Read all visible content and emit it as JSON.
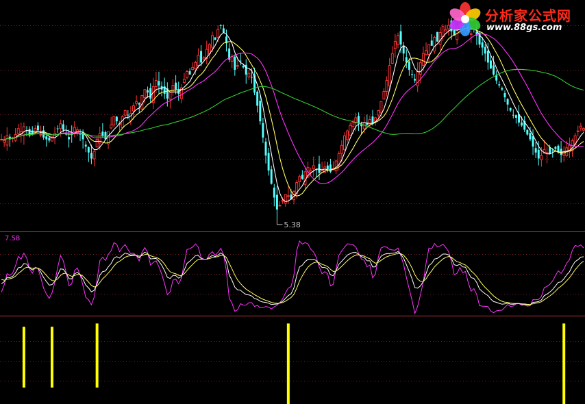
{
  "watermark": {
    "brand": "分析家公式网",
    "url": "www.88gs.com",
    "petal_colors": [
      "#ff3333",
      "#ffcc00",
      "#33cc33",
      "#3399ff",
      "#cc33ff",
      "#ff66cc"
    ]
  },
  "chart_data": [
    {
      "type": "candlestick",
      "panel": "price",
      "annotations": [
        {
          "text": "5.38",
          "marks": "lowest low",
          "x_index": 98
        }
      ],
      "colors": {
        "up": "#ff3333",
        "down": "#54ffff",
        "ma_short": "#ffffff",
        "ma_mid": "#ffff66",
        "ma_long": "#ff33ff",
        "ma_slow": "#33cc33"
      },
      "close_series": [
        6.72,
        6.7,
        6.78,
        6.72,
        6.75,
        6.8,
        6.9,
        6.85,
        6.93,
        6.86,
        6.78,
        6.82,
        6.9,
        6.87,
        6.8,
        6.75,
        6.72,
        6.7,
        6.76,
        6.82,
        6.9,
        6.98,
        6.88,
        6.8,
        6.72,
        6.8,
        6.92,
        6.88,
        6.8,
        6.72,
        6.6,
        6.5,
        6.4,
        6.52,
        6.72,
        6.82,
        6.78,
        6.72,
        6.85,
        6.96,
        7.1,
        7.02,
        6.98,
        7.1,
        7.2,
        7.12,
        7.15,
        7.28,
        7.35,
        7.3,
        7.45,
        7.55,
        7.5,
        7.4,
        7.6,
        7.7,
        7.62,
        7.55,
        7.48,
        7.4,
        7.5,
        7.62,
        7.55,
        7.48,
        7.58,
        7.72,
        7.85,
        7.8,
        7.92,
        8.0,
        8.12,
        8.0,
        8.08,
        8.22,
        8.3,
        8.45,
        8.38,
        8.55,
        8.62,
        8.5,
        8.32,
        8.05,
        8.1,
        7.88,
        7.95,
        8.02,
        7.92,
        7.8,
        7.82,
        7.75,
        7.5,
        7.28,
        7.02,
        6.75,
        6.45,
        6.2,
        5.98,
        5.75,
        5.55,
        5.62,
        5.7,
        5.8,
        5.78,
        5.72,
        5.85,
        6.0,
        6.1,
        6.06,
        6.18,
        6.25,
        6.2,
        6.28,
        6.22,
        6.16,
        6.2,
        6.26,
        6.22,
        6.18,
        6.24,
        6.36,
        6.48,
        6.62,
        6.78,
        6.86,
        6.95,
        7.0,
        7.08,
        6.98,
        6.94,
        7.0,
        6.96,
        7.05,
        6.98,
        7.08,
        7.2,
        7.35,
        7.52,
        7.7,
        7.95,
        8.15,
        8.35,
        8.45,
        8.3,
        8.15,
        8.0,
        7.88,
        7.8,
        7.7,
        7.85,
        8.0,
        8.15,
        8.2,
        8.3,
        8.28,
        8.42,
        8.35,
        8.5,
        8.6,
        8.55,
        8.62,
        8.52,
        8.45,
        8.55,
        8.62,
        8.58,
        8.66,
        8.52,
        8.48,
        8.55,
        8.45,
        8.3,
        8.25,
        8.15,
        8.0,
        7.9,
        7.8,
        7.7,
        7.62,
        7.55,
        7.42,
        7.3,
        7.2,
        7.12,
        7.08,
        7.0,
        6.95,
        6.88,
        6.8,
        6.72,
        6.6,
        6.5,
        6.4,
        6.45,
        6.55,
        6.5,
        6.48,
        6.52,
        6.56,
        6.5,
        6.46,
        6.52,
        6.58,
        6.62,
        6.7,
        6.78,
        6.86,
        6.94,
        6.9
      ]
    },
    {
      "type": "line",
      "panel": "oscillator",
      "annotations": [
        {
          "text": "7.58",
          "position": "top-left"
        }
      ],
      "series": [
        {
          "color": "#ff33ff"
        },
        {
          "color": "#ffffff"
        },
        {
          "color": "#ffff66"
        }
      ]
    },
    {
      "type": "bar",
      "panel": "signal",
      "color": "#ffff00",
      "bars": [
        {
          "x_index": 8,
          "value": 0.74
        },
        {
          "x_index": 18,
          "value": 0.74
        },
        {
          "x_index": 34,
          "value": 0.78
        },
        {
          "x_index": 102,
          "value": 0.98
        },
        {
          "x_index": 200,
          "value": 0.98
        }
      ]
    }
  ]
}
